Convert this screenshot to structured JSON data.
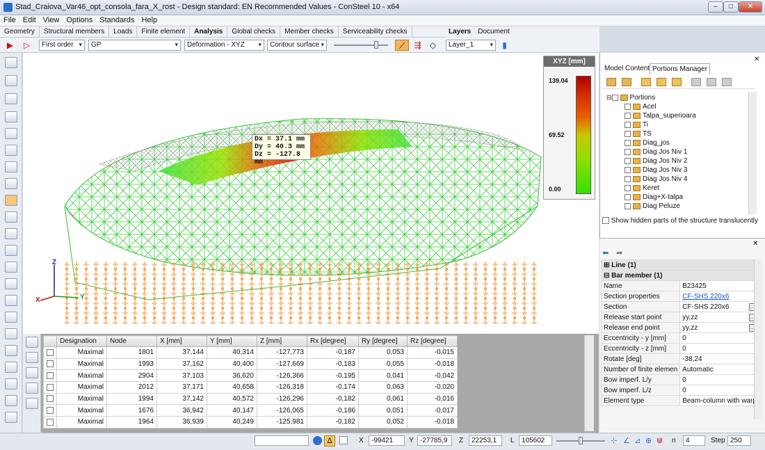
{
  "window": {
    "title": "Stad_Craiova_Var46_opt_consola_fara_X_rost - Design standard: EN Recommended Values - ConSteel 10 - x64"
  },
  "menu": [
    "File",
    "Edit",
    "View",
    "Options",
    "Standards",
    "Help"
  ],
  "tabs": [
    "Geometry",
    "Structural members",
    "Loads",
    "Finite element",
    "Analysis",
    "Global checks",
    "Member checks",
    "Serviceability checks"
  ],
  "active_tab": "Analysis",
  "layer_tabs": [
    "Layers",
    "Document"
  ],
  "toolbar": {
    "order": "First order",
    "load_group": "GP",
    "result": "Deformation - XYZ",
    "display": "Contour surface",
    "layer": "Layer_1"
  },
  "legend": {
    "title": "XYZ [mm]",
    "max": "139.04",
    "mid": "69.52",
    "min": "0.00"
  },
  "tooltip": {
    "dx": "Dx = 37.1 mm",
    "dy": "Dy = 40.3 mm",
    "dz": "Dz = -127.8 mm"
  },
  "axes": {
    "x": "X",
    "y": "Y",
    "z": "Z"
  },
  "grid": {
    "headers": [
      "Designation",
      "Node",
      "X [mm]",
      "Y [mm]",
      "Z [mm]",
      "Rx [degree]",
      "Ry [degree]",
      "Rz [degree]"
    ],
    "rows": [
      [
        "Maximal",
        "1801",
        "37,144",
        "40,314",
        "-127,773",
        "-0,187",
        "0,053",
        "-0,015"
      ],
      [
        "Maximal",
        "1993",
        "37,162",
        "40,400",
        "-127,669",
        "-0,183",
        "0,055",
        "-0,018"
      ],
      [
        "Maximal",
        "2904",
        "37,103",
        "36,620",
        "-126,366",
        "-0,195",
        "0,041",
        "-0,042"
      ],
      [
        "Maximal",
        "2012",
        "37,171",
        "40,658",
        "-126,318",
        "-0,174",
        "0,063",
        "-0,020"
      ],
      [
        "Maximal",
        "1994",
        "37,142",
        "40,572",
        "-126,296",
        "-0,182",
        "0,061",
        "-0,016"
      ],
      [
        "Maximal",
        "1676",
        "36,942",
        "40,147",
        "-126,065",
        "-0,186",
        "0,051",
        "-0,017"
      ],
      [
        "Maximal",
        "1964",
        "36,939",
        "40,249",
        "-125,981",
        "-0,182",
        "0,052",
        "-0,018"
      ]
    ]
  },
  "right_tabs": [
    "Model Content",
    "Portions Manager"
  ],
  "tree": {
    "root": "Portions",
    "items": [
      "Acel",
      "Talpa_superioara",
      "Ti",
      "TS",
      "Diag_jos",
      "Diag Jos Niv 1",
      "Diag Jos Niv 2",
      "Diag Jos Niv 3",
      "Diag Jos Niv 4",
      "Keret",
      "Diag+X-talpa",
      "Diag Peluze"
    ]
  },
  "show_hidden": "Show hidden parts of the structure translucently",
  "props": {
    "line_group": "Line (1)",
    "bar_group": "Bar member (1)",
    "rows": [
      [
        "Name",
        "B23425"
      ],
      [
        "Section properties",
        "CF-SHS 220x6"
      ],
      [
        "Section",
        "CF-SHS 220x6"
      ],
      [
        "Release start point",
        "yy,zz"
      ],
      [
        "Release end point",
        "yy,zz"
      ],
      [
        "Eccentricity - y [mm]",
        "0"
      ],
      [
        "Eccentricity - z [mm]",
        "0"
      ],
      [
        "Rotate [deg]",
        "-38,24"
      ],
      [
        "Number of finite elemen",
        "Automatic"
      ],
      [
        "Bow imperf. L/y",
        "0"
      ],
      [
        "Bow imperf. L/z",
        "0"
      ],
      [
        "Element type",
        "Beam-column with warp"
      ]
    ]
  },
  "status": {
    "x_label": "X",
    "x": "-99421",
    "y_label": "Y",
    "y": "-27785,9",
    "z_label": "Z",
    "z": "22253,1",
    "l_label": "L",
    "l": "105602",
    "n_label": "n",
    "n": "4",
    "step_label": "Step",
    "step": "250"
  }
}
